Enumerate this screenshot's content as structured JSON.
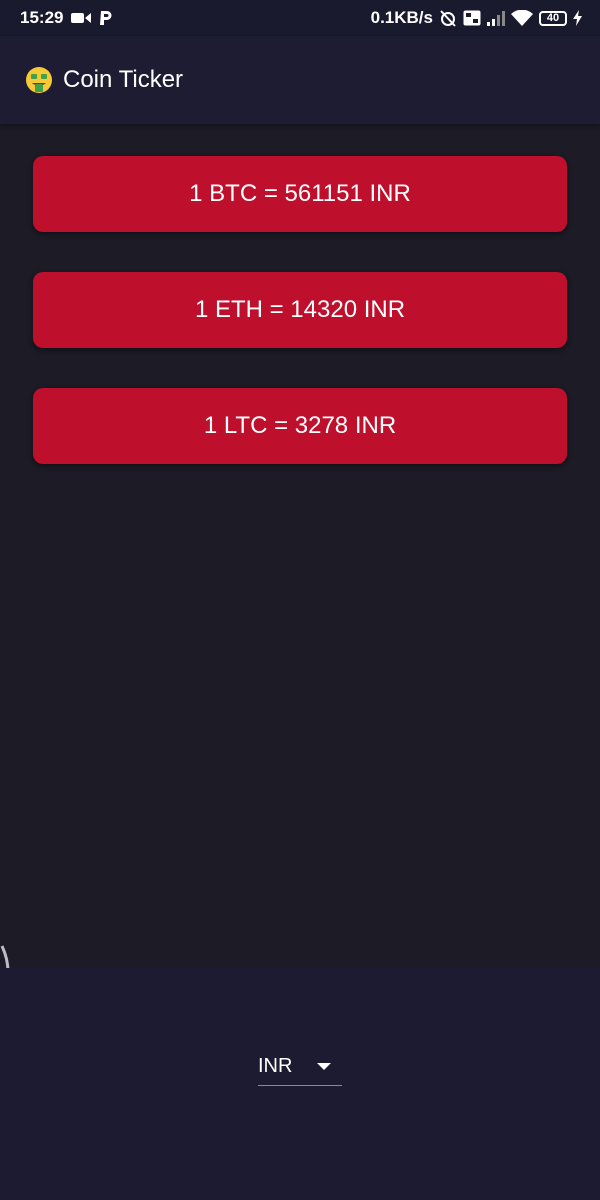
{
  "status_bar": {
    "time": "15:29",
    "network_speed": "0.1KB/s",
    "battery_level": "40",
    "icons": [
      "video-camera-icon",
      "parking-icon",
      "alarm-off-icon",
      "volte-icon",
      "signal-icon",
      "wifi-icon",
      "battery-icon",
      "charging-icon"
    ]
  },
  "app_bar": {
    "logo_icon": "money-mouth-face-icon",
    "title": "Coin Ticker"
  },
  "rates": [
    {
      "text": "1 BTC = 561151 INR"
    },
    {
      "text": "1 ETH = 14320 INR"
    },
    {
      "text": "1 LTC = 3278 INR"
    }
  ],
  "currency_picker": {
    "selected": "INR"
  },
  "colors": {
    "background": "#1c1b26",
    "app_bar": "#1e1c33",
    "card": "#be0f2c",
    "bottom_panel": "#1d1b32",
    "text": "#ffffff"
  }
}
